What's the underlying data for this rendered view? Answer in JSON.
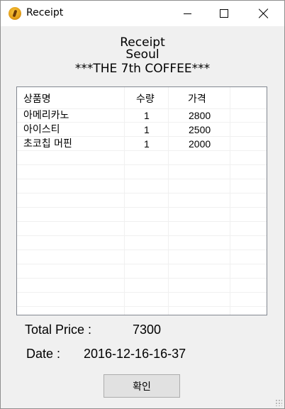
{
  "window": {
    "title": "Receipt",
    "icon": "coffee-bean-icon"
  },
  "header": {
    "line1": "Receipt",
    "line2": "Seoul",
    "line3": "***THE 7th COFFEE***"
  },
  "table": {
    "columns": [
      "상품명",
      "수량",
      "가격"
    ],
    "rows": [
      {
        "name": "아메리카노",
        "qty": "1",
        "price": "2800"
      },
      {
        "name": "아이스티",
        "qty": "1",
        "price": "2500"
      },
      {
        "name": "초코칩 머핀",
        "qty": "1",
        "price": "2000"
      }
    ]
  },
  "summary": {
    "total_label": "Total Price :",
    "total_value": "7300",
    "date_label": "Date :",
    "date_value": "2016-12-16-16-37"
  },
  "buttons": {
    "ok_label": "확인"
  }
}
